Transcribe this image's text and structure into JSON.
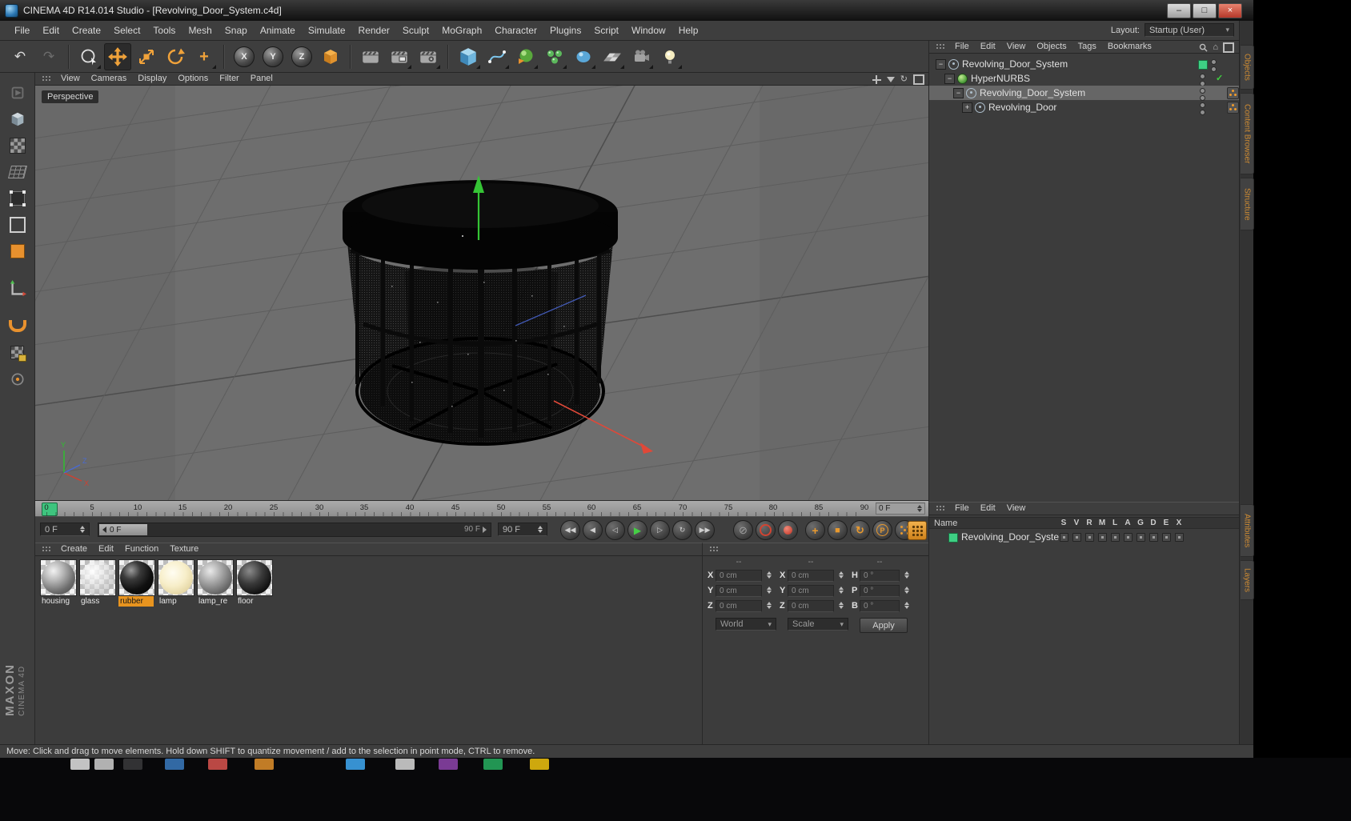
{
  "window": {
    "title": "CINEMA 4D R14.014 Studio - [Revolving_Door_System.c4d]"
  },
  "icons": {
    "undo": "↶",
    "redo": "↷",
    "minimize": "–",
    "maximize": "□",
    "close": "×",
    "dropdown": "▾",
    "home": "⌂",
    "refresh": "↻",
    "last_tool": "+",
    "check": "✓",
    "record_off": "⊘",
    "key_position": "+",
    "key_scale": "■",
    "key_rotation": "↻",
    "key_parameter": "P"
  },
  "menu_bar": {
    "items": [
      "File",
      "Edit",
      "Create",
      "Select",
      "Tools",
      "Mesh",
      "Snap",
      "Animate",
      "Simulate",
      "Render",
      "Sculpt",
      "MoGraph",
      "Character",
      "Plugins",
      "Script",
      "Window",
      "Help"
    ],
    "layout_label": "Layout:",
    "layout_value": "Startup (User)"
  },
  "toolbar": {
    "axis_x": "X",
    "axis_y": "Y",
    "axis_z": "Z"
  },
  "viewport": {
    "menus": [
      "View",
      "Cameras",
      "Display",
      "Options",
      "Filter",
      "Panel"
    ],
    "camera_label": "Perspective",
    "axis_labels": {
      "x": "X",
      "y": "Y",
      "z": "Z"
    }
  },
  "timeline": {
    "ticks": [
      "0",
      "5",
      "10",
      "15",
      "20",
      "25",
      "30",
      "35",
      "40",
      "45",
      "50",
      "55",
      "60",
      "65",
      "70",
      "75",
      "80",
      "85",
      "90"
    ],
    "ruler_field": "0 F",
    "current_field": "0 F",
    "range_start_chip": "0 F",
    "range_end_inline": "90 F",
    "range_end_field": "90 F",
    "transport": [
      "◀◀",
      "◀",
      "◁",
      "▶",
      "▷",
      "↻",
      "▶▶"
    ]
  },
  "materials": {
    "menus": [
      "Create",
      "Edit",
      "Function",
      "Texture"
    ],
    "items": [
      {
        "name": "housing"
      },
      {
        "name": "glass"
      },
      {
        "name": "rubber"
      },
      {
        "name": "lamp"
      },
      {
        "name": "lamp_re"
      },
      {
        "name": "floor"
      }
    ]
  },
  "coordinates": {
    "headers": [
      "--",
      "--",
      "--"
    ],
    "pos_labels": [
      "X",
      "Y",
      "Z"
    ],
    "size_labels": [
      "X",
      "Y",
      "Z"
    ],
    "rot_labels": [
      "H",
      "P",
      "B"
    ],
    "pos_values": [
      "0 cm",
      "0 cm",
      "0 cm"
    ],
    "size_values": [
      "0 cm",
      "0 cm",
      "0 cm"
    ],
    "rot_values": [
      "0 °",
      "0 °",
      "0 °"
    ],
    "world_dropdown": "World",
    "size_dropdown": "Scale",
    "apply_button": "Apply"
  },
  "object_manager": {
    "menus": [
      "File",
      "Edit",
      "View",
      "Objects",
      "Tags",
      "Bookmarks"
    ],
    "tree": [
      {
        "label": "Revolving_Door_System",
        "expander": "−"
      },
      {
        "label": "HyperNURBS",
        "expander": "−"
      },
      {
        "label": "Revolving_Door_System",
        "expander": "−"
      },
      {
        "label": "Revolving_Door",
        "expander": "+"
      }
    ]
  },
  "layer_manager": {
    "menus": [
      "File",
      "Edit",
      "View"
    ],
    "name_header": "Name",
    "columns": [
      "S",
      "V",
      "R",
      "M",
      "L",
      "A",
      "G",
      "D",
      "E",
      "X"
    ],
    "rows": [
      {
        "name": "Revolving_Door_System"
      }
    ]
  },
  "side_tabs": {
    "objects": "Objects",
    "content_browser": "Content Browser",
    "structure": "Structure",
    "attributes": "Attributes",
    "layers": "Layers"
  },
  "branding": {
    "maxon": "MAXON",
    "cinema": "CINEMA 4D"
  },
  "status_bar": {
    "text": "Move: Click and drag to move elements. Hold down SHIFT to quantize movement / add to the selection in point mode, CTRL to remove."
  }
}
